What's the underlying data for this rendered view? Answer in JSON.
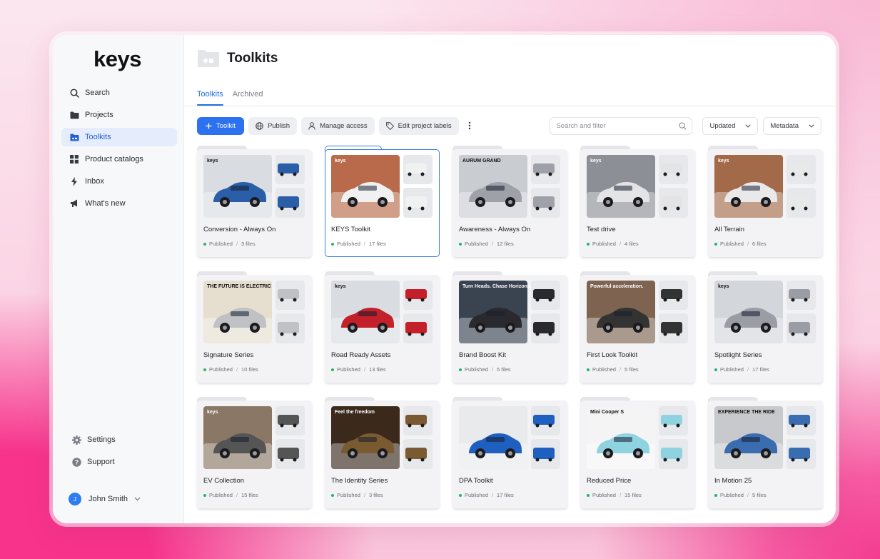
{
  "app": {
    "logo": "keys"
  },
  "sidebar": {
    "items": [
      {
        "label": "Search",
        "icon": "search-icon"
      },
      {
        "label": "Projects",
        "icon": "folder-icon"
      },
      {
        "label": "Toolkits",
        "icon": "toolkit-folder-icon",
        "active": true
      },
      {
        "label": "Product catalogs",
        "icon": "grid-icon"
      },
      {
        "label": "Inbox",
        "icon": "bolt-icon"
      },
      {
        "label": "What's new",
        "icon": "megaphone-icon"
      }
    ],
    "bottom": [
      {
        "label": "Settings",
        "icon": "gear-icon"
      },
      {
        "label": "Support",
        "icon": "help-icon"
      }
    ],
    "user": {
      "initial": "J",
      "name": "John Smith"
    }
  },
  "header": {
    "title": "Toolkits"
  },
  "tabs": [
    {
      "label": "Toolkits",
      "active": true
    },
    {
      "label": "Archived"
    }
  ],
  "toolbar": {
    "add_label": "Toolkit",
    "publish_label": "Publish",
    "manage_label": "Manage access",
    "labels_label": "Edit project labels",
    "search_placeholder": "Search and filter",
    "sort_label": "Updated",
    "metadata_label": "Metadata"
  },
  "colors": {
    "accent": "#2c72f0",
    "published_dot": "#27b36a",
    "active_nav_bg": "#e5ecfb"
  },
  "toolkits": [
    {
      "title": "Conversion - Always On",
      "status": "Published",
      "files": "3 files",
      "thumb": {
        "bg": "#d9dde2",
        "car": "#2a5ea8",
        "text": "keys"
      }
    },
    {
      "title": "KEYS Toolkit",
      "status": "Published",
      "files": "17 files",
      "selected": true,
      "thumb": {
        "bg": "#b96a4a",
        "car": "#f1f1f1",
        "text": "keys"
      }
    },
    {
      "title": "Awareness - Always On",
      "status": "Published",
      "files": "12 files",
      "thumb": {
        "bg": "#c9ccd1",
        "car": "#9ea2a8",
        "text": "AURUM GRAND"
      }
    },
    {
      "title": "Test drive",
      "status": "Published",
      "files": "4 files",
      "thumb": {
        "bg": "#8c8f96",
        "car": "#e4e4e6",
        "text": "keys"
      }
    },
    {
      "title": "All Terrain",
      "status": "Published",
      "files": "6 files",
      "thumb": {
        "bg": "#a36a49",
        "car": "#e9e9ea",
        "text": "keys"
      }
    },
    {
      "title": "Signature Series",
      "status": "Published",
      "files": "10 files",
      "thumb": {
        "bg": "#e6dfcf",
        "car": "#bfc1c4",
        "text": "THE FUTURE IS ELECTRIC"
      }
    },
    {
      "title": "Road Ready Assets",
      "status": "Published",
      "files": "13 files",
      "thumb": {
        "bg": "#d9dde2",
        "car": "#c4202a",
        "text": "keys"
      }
    },
    {
      "title": "Brand Boost Kit",
      "status": "Published",
      "files": "5 files",
      "thumb": {
        "bg": "#3a4350",
        "car": "#2a2a2e",
        "text": "Turn Heads. Chase Horizons."
      }
    },
    {
      "title": "First Look Toolkit",
      "status": "Published",
      "files": "5 files",
      "thumb": {
        "bg": "#7d6350",
        "car": "#333333",
        "text": "Powerful acceleration."
      }
    },
    {
      "title": "Spotlight Series",
      "status": "Published",
      "files": "17 files",
      "thumb": {
        "bg": "#d3d6da",
        "car": "#9a9ea4",
        "text": "keys"
      }
    },
    {
      "title": "EV Collection",
      "status": "Published",
      "files": "15 files",
      "thumb": {
        "bg": "#8a7766",
        "car": "#555555",
        "text": "keys"
      }
    },
    {
      "title": "The Identity Series",
      "status": "Published",
      "files": "3 files",
      "thumb": {
        "bg": "#3b2a1c",
        "car": "#7a5a30",
        "text": "Feel the freedom"
      }
    },
    {
      "title": "DPA Toolkit",
      "status": "Published",
      "files": "17 files",
      "thumb": {
        "bg": "#e9eaec",
        "car": "#1f5fbf",
        "text": ""
      }
    },
    {
      "title": "Reduced Price",
      "status": "Published",
      "files": "15 files",
      "thumb": {
        "bg": "#f4f4f4",
        "car": "#8fd3e0",
        "text": "Mini Cooper S"
      }
    },
    {
      "title": "In Motion 25",
      "status": "Published",
      "files": "5 files",
      "thumb": {
        "bg": "#c7c9cc",
        "car": "#3a6db0",
        "text": "EXPERIENCE THE RIDE"
      }
    }
  ]
}
